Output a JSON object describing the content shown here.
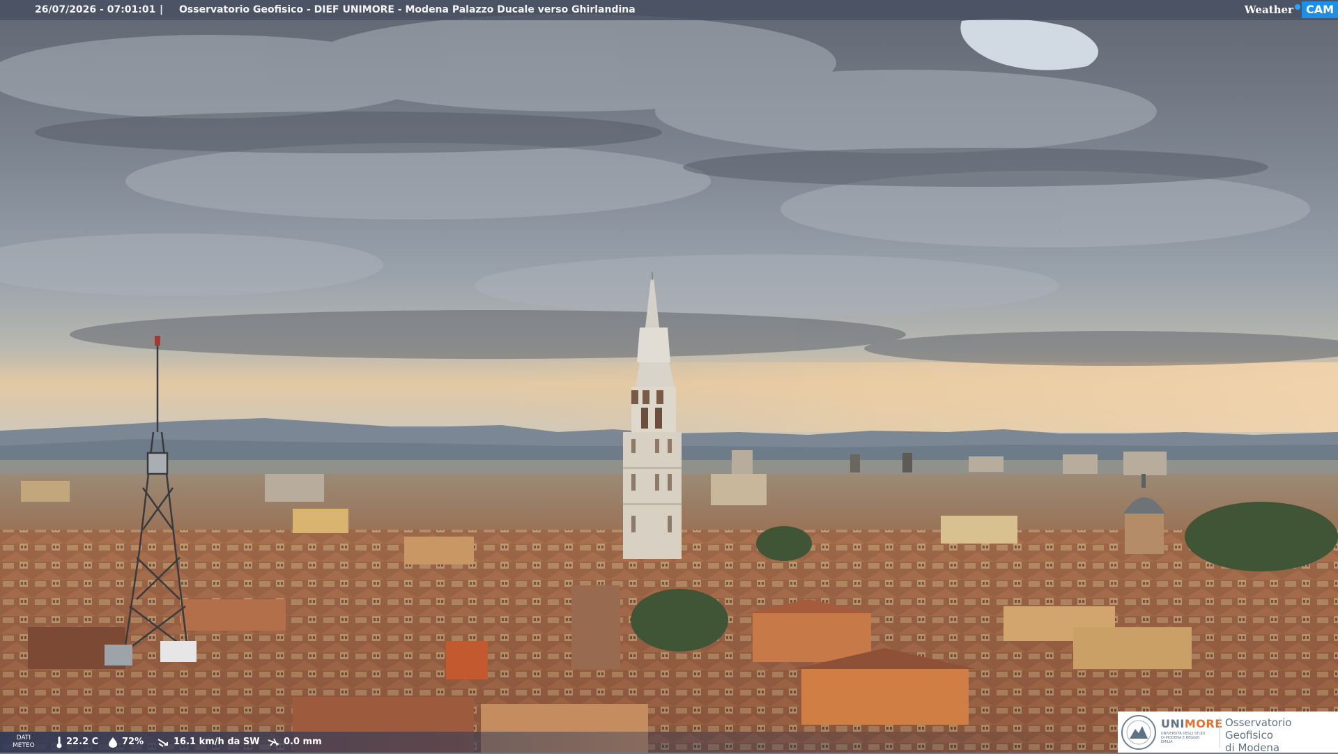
{
  "header": {
    "datetime": "26/07/2026 - 07:01:01",
    "separator": "|",
    "caption": "Osservatorio Geofisico - DIEF UNIMORE - Modena Palazzo Ducale verso Ghirlandina"
  },
  "brand": {
    "weather_text": "Weather",
    "cam_text": "CAM",
    "accent": "#1e8fe6"
  },
  "meteo": {
    "label_line1": "DATI",
    "label_line2": "METEO",
    "temperature": "22.2 C",
    "humidity": "72%",
    "wind": "16.1 km/h da SW",
    "rain": "0.0 mm",
    "icons": [
      "thermometer-icon",
      "humidity-drop-icon",
      "wind-icon",
      "rain-icon"
    ]
  },
  "institution": {
    "uni_part1": "UNI",
    "uni_part2": "MORE",
    "uni_subtitle": "UNIVERSITÀ DEGLI STUDI DI MODENA E REGGIO EMILIA",
    "observatory_line1": "Osservatorio Geofisico",
    "observatory_line2": "di Modena",
    "colors": {
      "grey": "#5e7384",
      "orange": "#e2712b"
    }
  }
}
